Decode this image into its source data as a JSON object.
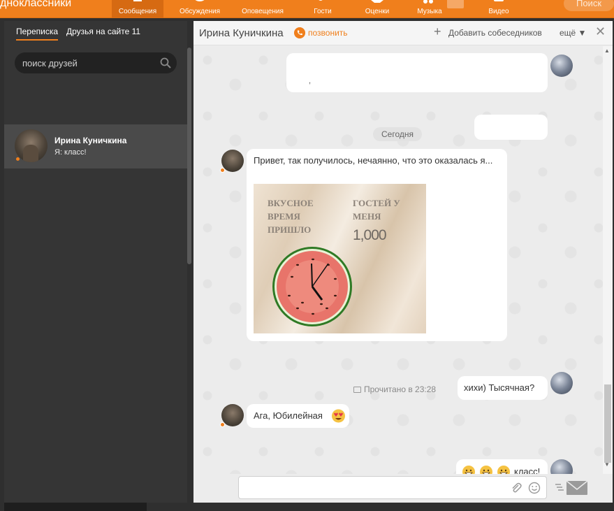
{
  "topbar": {
    "brand": "дноклассники",
    "nav": [
      {
        "label": "Сообщения",
        "icon": "messages-icon"
      },
      {
        "label": "Обсуждения",
        "icon": "discussions-icon"
      },
      {
        "label": "Оповещения",
        "icon": "bell-icon"
      },
      {
        "label": "Гости",
        "icon": "guests-icon"
      },
      {
        "label": "Оценки",
        "icon": "ratings-icon"
      },
      {
        "label": "Музыка",
        "icon": "music-icon"
      },
      {
        "label": "Видео",
        "icon": "video-icon"
      }
    ],
    "search_label": "Поиск",
    "accent": "#f07f1c"
  },
  "sidebar": {
    "tab_conversations": "Переписка",
    "tab_friends": "Друзья на сайте 11",
    "search_placeholder": "поиск друзей",
    "contact": {
      "name": "Ирина Куничкина",
      "last_message": "Я: класс!"
    }
  },
  "chat": {
    "title": "Ирина Куничкина",
    "call_label": "позвонить",
    "add_label": "Добавить собеседников",
    "more_label": "ещё ▼",
    "date_divider": "Сегодня",
    "messages": {
      "incoming_1": "Привет, так получилось, нечаянно, что это оказалась я...",
      "image_text_left": "ВКУСНОЕ ВРЕМЯ ПРИШЛО",
      "image_text_right": "ГОСТЕЙ У МЕНЯ",
      "image_count": "1,000",
      "outgoing_1": "хихи) Тысячная?",
      "read_status": "Прочитано в 23:28",
      "incoming_2": "Ага, Юбилейная",
      "outgoing_2": "класс!"
    }
  }
}
